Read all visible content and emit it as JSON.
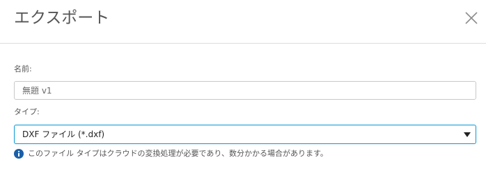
{
  "dialog": {
    "title": "エクスポート",
    "close_icon": "close-icon"
  },
  "name_field": {
    "label": "名前:",
    "value": "無題 v1"
  },
  "type_field": {
    "label": "タイプ:",
    "selected": "DXF ファイル (*.dxf)",
    "arrow_icon": "caret-down-icon"
  },
  "info": {
    "icon": "info-icon",
    "text": "このファイル タイプはクラウドの変換処理が必要であり、数分かかる場合があります。"
  },
  "colors": {
    "focus_border": "#0696d7",
    "info_icon": "#1a5fa8",
    "divider": "#dcdcdc"
  }
}
